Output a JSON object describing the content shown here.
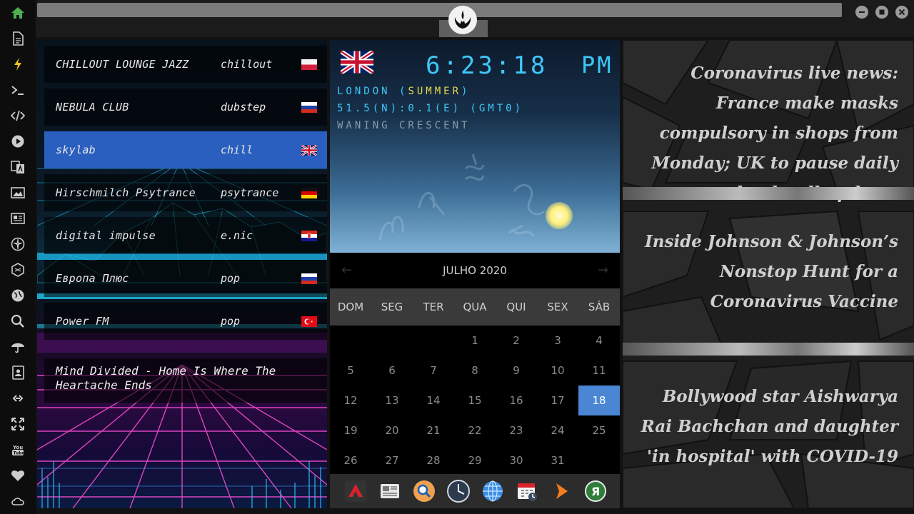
{
  "rail": {
    "items": [
      {
        "icon": "home-icon",
        "color": "#4caf50"
      },
      {
        "icon": "file-icon",
        "color": "#cccccc"
      },
      {
        "icon": "lightning-icon",
        "color": "#f5c518"
      },
      {
        "icon": "terminal-icon",
        "color": "#cccccc"
      },
      {
        "icon": "code-icon",
        "color": "#cccccc"
      },
      {
        "icon": "play-icon",
        "color": "#cccccc"
      },
      {
        "icon": "translate-icon",
        "color": "#cccccc"
      },
      {
        "icon": "image-icon",
        "color": "#cccccc"
      },
      {
        "icon": "newspaper-icon",
        "color": "#cccccc"
      },
      {
        "icon": "rebel-icon",
        "color": "#cccccc"
      },
      {
        "icon": "hexagon-icon",
        "color": "#cccccc"
      },
      {
        "icon": "globe-icon",
        "color": "#cccccc"
      },
      {
        "icon": "search-icon",
        "color": "#cccccc"
      },
      {
        "icon": "umbrella-icon",
        "color": "#cccccc"
      },
      {
        "icon": "contacts-icon",
        "color": "#cccccc"
      },
      {
        "icon": "link-icon",
        "color": "#cccccc"
      },
      {
        "icon": "fullscreen-icon",
        "color": "#cccccc"
      },
      {
        "icon": "youtube-icon",
        "color": "#cccccc"
      },
      {
        "icon": "heart-icon",
        "color": "#cccccc"
      },
      {
        "icon": "cloud-icon",
        "color": "#cccccc"
      }
    ]
  },
  "radio": {
    "stations": [
      {
        "name": "CHILLOUT LOUNGE JAZZ",
        "genre": "chillout",
        "flag": "poland",
        "active": false
      },
      {
        "name": "NEBULA CLUB",
        "genre": "dubstep",
        "flag": "russia",
        "active": false
      },
      {
        "name": "skylab",
        "genre": "chill",
        "flag": "uk",
        "active": true
      },
      {
        "name": "Hirschmilch Psytrance",
        "genre": "psytrance",
        "flag": "germany",
        "active": false
      },
      {
        "name": "digital impulse",
        "genre": "e.nic",
        "flag": "croatia",
        "active": false
      },
      {
        "name": "Европа Плюс",
        "genre": "pop",
        "flag": "russia",
        "active": false
      },
      {
        "name": "Power FM",
        "genre": "pop",
        "flag": "turkey",
        "active": false
      }
    ],
    "now_playing": "Mind Divided - Home Is Where The Heartache Ends"
  },
  "clock": {
    "time": "6:23:18",
    "ampm": "PM",
    "location_prefix": "LONDON (",
    "location_season": "SUMMER",
    "location_suffix": ")",
    "coords": "51.5(N):0.1(E) (GMT0)",
    "moon": "WANING CRESCENT",
    "time_color": "#3ec7f7",
    "season_color": "#e8d84a"
  },
  "calendar": {
    "month_label": "JULHO 2020",
    "prev_arrow": "←",
    "next_arrow": "→",
    "day_headers": [
      "DOM",
      "SEG",
      "TER",
      "QUA",
      "QUI",
      "SEX",
      "SÁB"
    ],
    "weeks": [
      [
        "",
        "",
        "",
        "1",
        "2",
        "3",
        "4"
      ],
      [
        "5",
        "6",
        "7",
        "8",
        "9",
        "10",
        "11"
      ],
      [
        "12",
        "13",
        "14",
        "15",
        "16",
        "17",
        "18"
      ],
      [
        "19",
        "20",
        "21",
        "22",
        "23",
        "24",
        "25"
      ],
      [
        "26",
        "27",
        "28",
        "29",
        "30",
        "31",
        ""
      ]
    ],
    "today": "18",
    "today_color": "#4a86d4"
  },
  "dock": {
    "icons": [
      "arrow-app-icon",
      "news-app-icon",
      "search-app-icon",
      "clock-app-icon",
      "globe-app-icon",
      "calendar-app-icon",
      "play-app-icon",
      "yandex-app-icon"
    ]
  },
  "news": {
    "items": [
      "Coronavirus live news: France make masks compulsory in shops from Monday; UK to pause daily death toll updates",
      "Inside Johnson & Johnson’s Nonstop Hunt for a Coronavirus Vaccine",
      "Bollywood star Aishwarya Rai Bachchan and daughter 'in hospital' with COVID-19"
    ]
  }
}
